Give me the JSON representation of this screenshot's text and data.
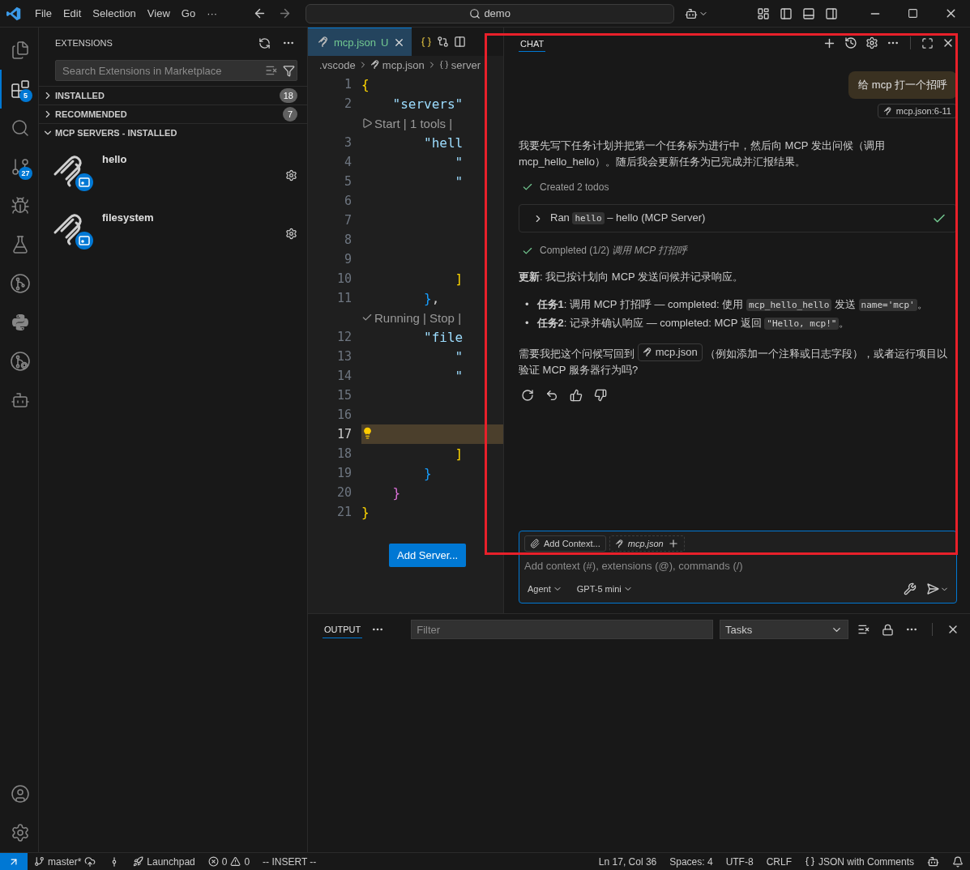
{
  "title_bar": {
    "menus": [
      "File",
      "Edit",
      "Selection",
      "View",
      "Go",
      "···"
    ],
    "search": "demo"
  },
  "activity_bar": {
    "items": [
      {
        "kind": "files",
        "selected": false
      },
      {
        "kind": "extensions",
        "selected": true,
        "badge": "5"
      },
      {
        "kind": "search",
        "selected": false
      },
      {
        "kind": "source-control",
        "selected": false,
        "badge": "27"
      },
      {
        "kind": "run-debug",
        "selected": false
      },
      {
        "kind": "testing",
        "selected": false
      },
      {
        "kind": "git-graph",
        "selected": false
      },
      {
        "kind": "python",
        "selected": false
      },
      {
        "kind": "git-lens",
        "selected": false
      },
      {
        "kind": "copilot",
        "selected": false
      }
    ],
    "bottom": [
      {
        "kind": "account"
      },
      {
        "kind": "settings"
      }
    ]
  },
  "sidebar": {
    "title": "EXTENSIONS",
    "search_placeholder": "Search Extensions in Marketplace",
    "sections": [
      {
        "label": "INSTALLED",
        "count": "18",
        "expanded": false
      },
      {
        "label": "RECOMMENDED",
        "count": "7",
        "expanded": false
      },
      {
        "label": "MCP SERVERS - INSTALLED",
        "expanded": true,
        "items": [
          {
            "name": "hello"
          },
          {
            "name": "filesystem"
          }
        ]
      }
    ]
  },
  "editor": {
    "tabs": [
      {
        "label": "mcp.json",
        "status": "U",
        "selected": true
      }
    ],
    "breadcrumbs": [
      ".vscode",
      "mcp.json",
      "server"
    ],
    "lines": [
      {
        "kind": "code",
        "number": "1",
        "current": false,
        "tokens": [
          {
            "kind": "bracket1",
            "text": "{"
          }
        ]
      },
      {
        "kind": "code",
        "number": "2",
        "current": false,
        "tokens": [
          {
            "kind": "key",
            "text": "    \"servers\""
          }
        ]
      },
      {
        "kind": "lens",
        "running": false,
        "text": "Start | 1 tools |"
      },
      {
        "kind": "code",
        "number": "3",
        "current": false,
        "tokens": [
          {
            "kind": "key",
            "text": "        \"hell"
          }
        ]
      },
      {
        "kind": "code",
        "number": "4",
        "current": false,
        "tokens": [
          {
            "kind": "key",
            "text": "            \""
          }
        ]
      },
      {
        "kind": "code",
        "number": "5",
        "current": false,
        "tokens": [
          {
            "kind": "key",
            "text": "            \""
          }
        ]
      },
      {
        "kind": "code",
        "number": "6",
        "current": false
      },
      {
        "kind": "code",
        "number": "7",
        "current": false
      },
      {
        "kind": "code",
        "number": "8",
        "current": false
      },
      {
        "kind": "code",
        "number": "9",
        "current": false
      },
      {
        "kind": "code",
        "number": "10",
        "current": false,
        "tokens": [
          {
            "kind": "bracket1",
            "text": "            ]"
          }
        ]
      },
      {
        "kind": "code",
        "number": "11",
        "current": false,
        "tokens": [
          {
            "kind": "bracket3",
            "text": "        }"
          },
          {
            "kind": "punct",
            "text": ","
          }
        ]
      },
      {
        "kind": "lens",
        "running": true,
        "text": "Running | Stop |"
      },
      {
        "kind": "code",
        "number": "12",
        "current": false,
        "tokens": [
          {
            "kind": "key",
            "text": "        \"file"
          }
        ]
      },
      {
        "kind": "code",
        "number": "13",
        "current": false,
        "tokens": [
          {
            "kind": "key",
            "text": "            \""
          }
        ]
      },
      {
        "kind": "code",
        "number": "14",
        "current": false,
        "tokens": [
          {
            "kind": "key",
            "text": "            \""
          }
        ]
      },
      {
        "kind": "code",
        "number": "15",
        "current": false
      },
      {
        "kind": "code",
        "number": "16",
        "current": false
      },
      {
        "kind": "code",
        "number": "17",
        "current": true
      },
      {
        "kind": "code",
        "number": "18",
        "current": false,
        "tokens": [
          {
            "kind": "bracket1",
            "text": "            ]"
          }
        ]
      },
      {
        "kind": "code",
        "number": "19",
        "current": false,
        "tokens": [
          {
            "kind": "bracket3",
            "text": "        }"
          }
        ]
      },
      {
        "kind": "code",
        "number": "20",
        "current": false,
        "tokens": [
          {
            "kind": "bracket2",
            "text": "    }"
          }
        ]
      },
      {
        "kind": "code",
        "number": "21",
        "current": false,
        "tokens": [
          {
            "kind": "bracket1",
            "text": "}"
          }
        ]
      }
    ],
    "add_server_button": "Add Server..."
  },
  "chat": {
    "title": "CHAT",
    "user_message": "给 mcp 打一个招呼",
    "attachment": "mcp.json:6-11",
    "blocks": [
      {
        "kind": "paragraph",
        "segments": [
          {
            "kind": "text",
            "text": "我要先写下任务计划并把第一个任务标为进行中，然后向 MCP 发出问候（调用 mcp_hello_hello）。随后我会更新任务为已完成并汇报结果。"
          }
        ]
      },
      {
        "kind": "progress",
        "done": true,
        "text": "Created 2 todos"
      },
      {
        "kind": "tool",
        "done": true,
        "segments": [
          {
            "kind": "text",
            "text": "Ran "
          },
          {
            "kind": "code",
            "text": "hello"
          },
          {
            "kind": "text",
            "text": " – hello (MCP Server)"
          }
        ]
      },
      {
        "kind": "progress",
        "done": true,
        "text": "Completed (1/2) *调用 MCP 打招呼*"
      },
      {
        "kind": "paragraph",
        "segments": [
          {
            "kind": "text",
            "text": "**更新**: 我已按计划向 MCP 发送问候并记录响应。"
          }
        ]
      },
      {
        "kind": "bullets",
        "items": [
          {
            "marker": "•",
            "segments": [
              {
                "kind": "text",
                "text": "**任务1**: 调用 MCP 打招呼 — completed: 使用 "
              },
              {
                "kind": "code",
                "text": "mcp_hello_hello"
              },
              {
                "kind": "text",
                "text": " 发送 "
              },
              {
                "kind": "code",
                "text": "name='mcp'"
              },
              {
                "kind": "text",
                "text": "。"
              }
            ]
          },
          {
            "marker": "•",
            "segments": [
              {
                "kind": "text",
                "text": "**任务2**: 记录并确认响应 — completed: MCP 返回 "
              },
              {
                "kind": "code",
                "text": "\"Hello, mcp!\""
              },
              {
                "kind": "text",
                "text": "。"
              }
            ]
          }
        ]
      },
      {
        "kind": "paragraph",
        "segments": [
          {
            "kind": "text",
            "text": "需要我把这个问候写回到 "
          },
          {
            "kind": "file-link",
            "text": "mcp.json"
          },
          {
            "kind": "text",
            "text": " （例如添加一个注释或日志字段），或者运行项目以验证 MCP 服务器行为吗?"
          }
        ]
      },
      {
        "kind": "actions"
      }
    ],
    "input": {
      "chips": [
        {
          "kind": "add-context",
          "text": "Add Context..."
        },
        {
          "kind": "file",
          "text": "mcp.json"
        }
      ],
      "placeholder": "Add context (#), extensions (@), commands (/)",
      "mode": "Agent",
      "model": "GPT-5 mini"
    }
  },
  "highlight": {
    "kind": "frame"
  },
  "panel": {
    "tabs": [
      {
        "label": "OUTPUT",
        "selected": true
      }
    ],
    "filter_placeholder": "Filter",
    "channel": "Tasks"
  },
  "status_bar": {
    "branch": "master*",
    "launchpad": "Launchpad",
    "errors": "0",
    "warnings": "0",
    "mode": "-- INSERT --",
    "right": [
      {
        "kind": "text",
        "text": "Ln 17, Col 36"
      },
      {
        "kind": "text",
        "text": "Spaces: 4"
      },
      {
        "kind": "text",
        "text": "UTF-8"
      },
      {
        "kind": "text",
        "text": "CRLF"
      },
      {
        "kind": "language",
        "text": "JSON with Comments"
      }
    ]
  }
}
